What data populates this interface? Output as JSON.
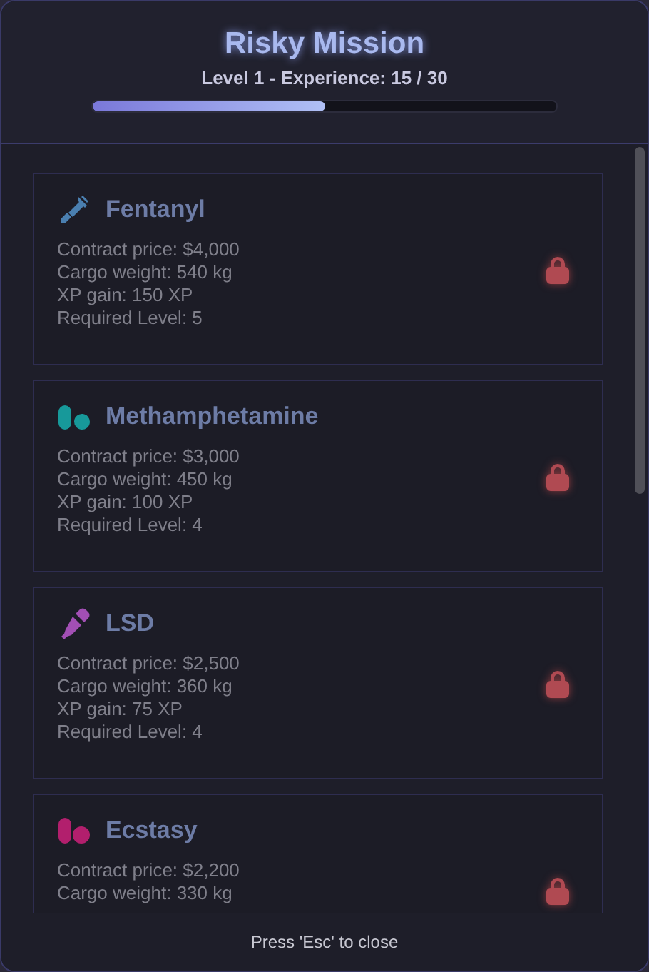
{
  "header": {
    "title": "Risky Mission",
    "subtitle": "Level 1 - Experience: 15 / 30",
    "level": 0.5
  },
  "missions": [
    {
      "name": "Fentanyl",
      "kind": "syringe",
      "color": "#4a7fb0",
      "locked": true,
      "details": [
        "Contract price: $4,000",
        "Cargo weight: 540 kg",
        "XP gain: 150 XP",
        "Required Level: 5"
      ]
    },
    {
      "name": "Methamphetamine",
      "kind": "capsules",
      "color": "#17999a",
      "locked": true,
      "details": [
        "Contract price: $3,000",
        "Cargo weight: 450 kg",
        "XP gain: 100 XP",
        "Required Level: 4"
      ]
    },
    {
      "name": "LSD",
      "kind": "dropper",
      "color": "#a24fb4",
      "locked": true,
      "details": [
        "Contract price: $2,500",
        "Cargo weight: 360 kg",
        "XP gain: 75 XP",
        "Required Level: 4"
      ]
    },
    {
      "name": "Ecstasy",
      "kind": "pills",
      "color": "#b21f6d",
      "locked": true,
      "details": [
        "Contract price: $2,200",
        "Cargo weight: 330 kg"
      ]
    }
  ],
  "footer": "Press 'Esc' to close"
}
